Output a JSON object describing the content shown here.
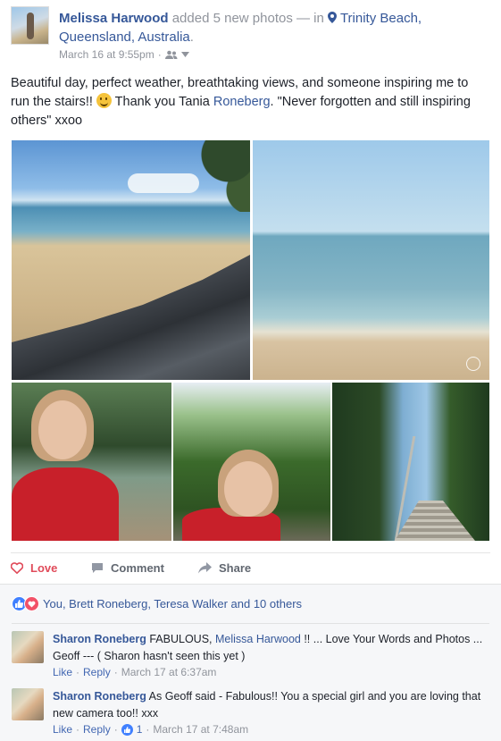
{
  "header": {
    "author": "Melissa Harwood",
    "action": "added 5 new photos",
    "separator": "— in",
    "location": "Trinity Beach, Queensland, Australia",
    "location_suffix": ".",
    "timestamp": "March 16 at 9:55pm",
    "dot": "·"
  },
  "caption": {
    "part1": "Beautiful day, perfect weather, breathtaking views, and someone inspiring me to run the stairs!!",
    "part2": " Thank you Tania ",
    "mention": "Roneberg",
    "part3": ". \"Never forgotten and still inspiring others\" xxoo"
  },
  "actions": {
    "love": "Love",
    "comment": "Comment",
    "share": "Share"
  },
  "reactions": {
    "summary": "You, Brett Roneberg, Teresa Walker and 10 others",
    "like_color": "#4080ff",
    "love_color": "#f25268"
  },
  "comments": [
    {
      "name": "Sharon Roneberg",
      "text_before": " FABULOUS, ",
      "mention": "Melissa Harwood",
      "text_after": " !! ... Love Your Words and Photos ... Geoff --- ( Sharon hasn't seen this yet )",
      "like": "Like",
      "reply": "Reply",
      "dot": "·",
      "time": "March 17 at 6:37am"
    },
    {
      "name": "Sharon Roneberg",
      "text": " As Geoff said - Fabulous!! You a special girl and you are loving that new camera too!! xxx",
      "like": "Like",
      "reply": "Reply",
      "dot": "·",
      "reaction_count": "1",
      "time": "March 17 at 7:48am"
    }
  ],
  "colors": {
    "link": "#365899",
    "love_accent": "#e04b5a",
    "meta_gray": "#90949c"
  }
}
